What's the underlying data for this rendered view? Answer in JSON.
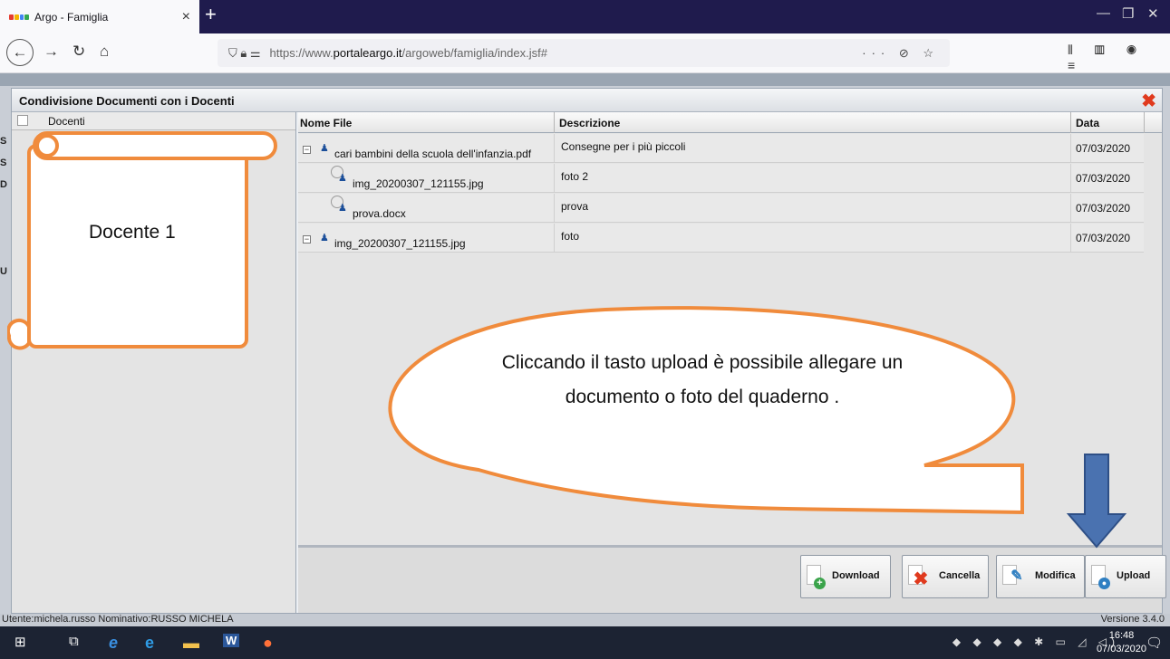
{
  "browser": {
    "tab_title": "Argo - Famiglia",
    "tab_close": "×",
    "new_tab": "+",
    "window_controls": [
      "—",
      "❐",
      "✕"
    ],
    "url_prefix": "https://www.",
    "url_domain": "portaleargo.it",
    "url_path": "/argoweb/famiglia/index.jsf#",
    "url_actions": "··· ⊘ ☆",
    "toolbar_right": "⫴ ▥ ◉ ≡"
  },
  "left_edge_letters": [
    "S",
    "S",
    "D",
    "",
    "",
    "",
    "U"
  ],
  "dialog": {
    "title": "Condivisione Documenti con i Docenti",
    "close": "✖",
    "left_header": "Docenti",
    "columns": {
      "file": "Nome File",
      "description": "Descrizione",
      "date": "Data"
    },
    "rows": [
      {
        "file": "cari bambini della scuola dell'infanzia.pdf",
        "description": "Consegne per i più piccoli",
        "date": "07/03/2020",
        "toggle": "−"
      },
      {
        "file": "img_20200307_121155.jpg",
        "description": "foto 2",
        "date": "07/03/2020",
        "toggle": ""
      },
      {
        "file": "prova.docx",
        "description": "prova",
        "date": "07/03/2020",
        "toggle": ""
      },
      {
        "file": "img_20200307_121155.jpg",
        "description": "foto",
        "date": "07/03/2020",
        "toggle": "−"
      }
    ],
    "buttons": {
      "download": "Download",
      "delete": "Cancella",
      "edit": "Modifica",
      "upload": "Upload"
    }
  },
  "status": {
    "user": "Utente:michela.russo Nominativo:RUSSO MICHELA",
    "version": "Versione 3.4.0"
  },
  "annotations": {
    "scroll_text": "Docente 1",
    "bubble_text": "Cliccando il tasto upload  è possibile allegare un documento o foto del quaderno ."
  },
  "taskbar": {
    "time": "16:48",
    "date": "07/03/2020",
    "tray": "◆ ◆ ◆ ◆ ✱ ▭ ◿ ◁)"
  },
  "colors": {
    "annotation_outline": "#f08b3c",
    "arrow_fill": "#4a72b0",
    "person_icon": "#1c4f9a",
    "close_red": "#e03a1e",
    "download_badge": "#3aa34a",
    "upload_badge": "#2f7fc2"
  }
}
